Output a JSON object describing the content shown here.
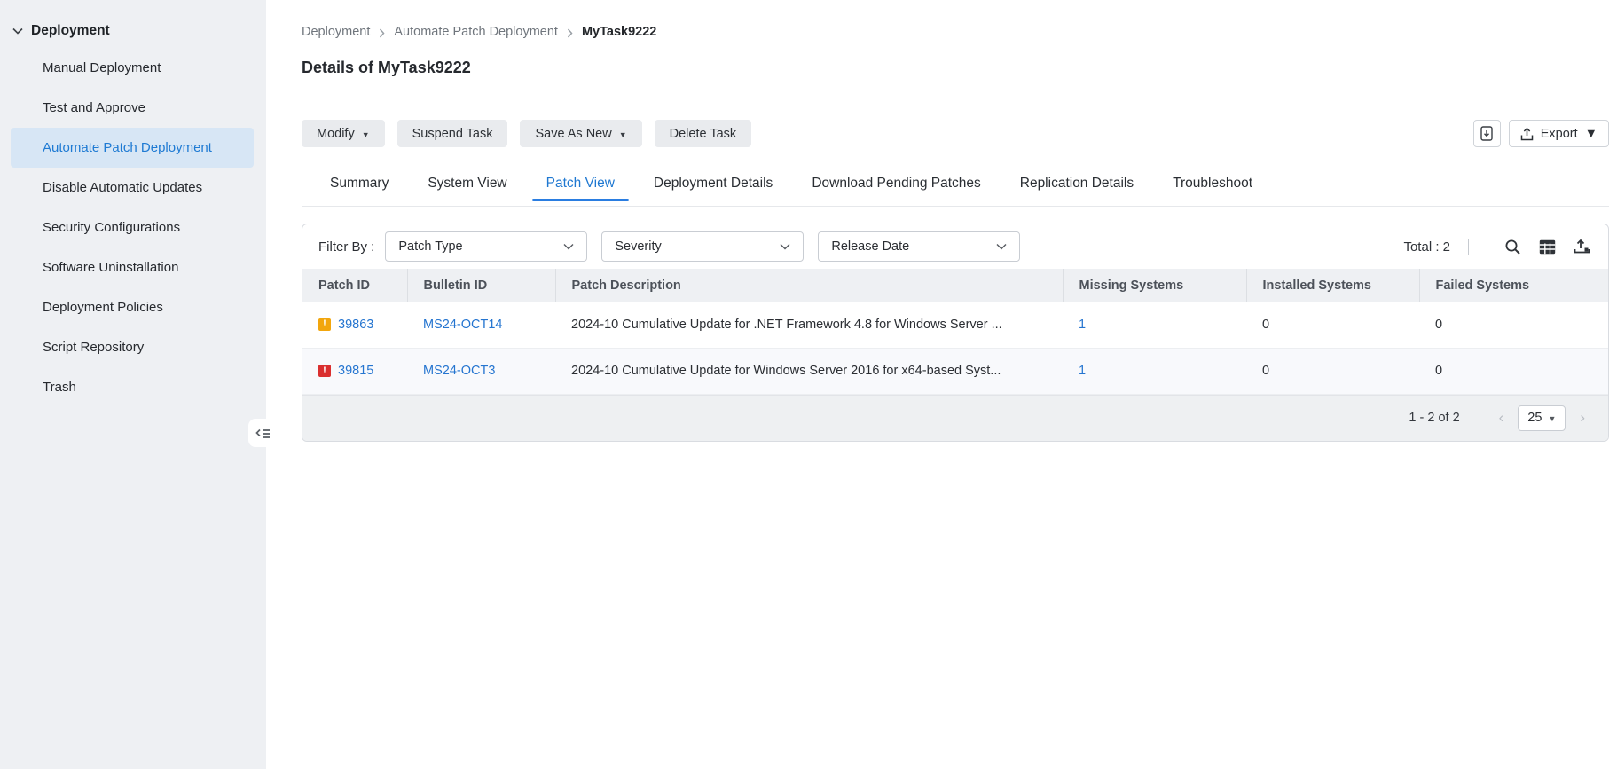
{
  "sidebar": {
    "section": "Deployment",
    "active_item": "Automate Patch Deployment",
    "items": [
      "Manual Deployment",
      "Test and Approve",
      "Automate Patch Deployment",
      "Disable Automatic Updates",
      "Security Configurations",
      "Software Uninstallation",
      "Deployment Policies",
      "Script Repository",
      "Trash"
    ]
  },
  "breadcrumb": {
    "items": [
      "Deployment",
      "Automate Patch Deployment",
      "MyTask9222"
    ]
  },
  "page": {
    "title": "Details of MyTask9222"
  },
  "toolbar": {
    "modify": "Modify",
    "suspend": "Suspend Task",
    "save_as_new": "Save As New",
    "delete": "Delete Task",
    "export": "Export"
  },
  "tabs": {
    "active": "Patch View",
    "items": [
      "Summary",
      "System View",
      "Patch View",
      "Deployment Details",
      "Download Pending Patches",
      "Replication Details",
      "Troubleshoot"
    ]
  },
  "filter": {
    "label": "Filter By :",
    "dropdowns": [
      "Patch Type",
      "Severity",
      "Release Date"
    ],
    "total": "Total : 2"
  },
  "table": {
    "columns": [
      "Patch ID",
      "Bulletin ID",
      "Patch Description",
      "Missing Systems",
      "Installed Systems",
      "Failed Systems"
    ],
    "rows": [
      {
        "severity": "important",
        "color": "#f2a60d",
        "glyph": "!",
        "patch_id": "39863",
        "bulletin_id": "MS24-OCT14",
        "description": "2024-10 Cumulative Update for .NET Framework 4.8 for Windows Server ...",
        "missing": "1",
        "installed": "0",
        "failed": "0"
      },
      {
        "severity": "critical",
        "color": "#da2f2f",
        "glyph": "!",
        "patch_id": "39815",
        "bulletin_id": "MS24-OCT3",
        "description": "2024-10 Cumulative Update for Windows Server 2016 for x64-based Syst...",
        "missing": "1",
        "installed": "0",
        "failed": "0"
      }
    ]
  },
  "pagination": {
    "range": "1 - 2 of 2",
    "page_size": "25"
  },
  "colors": {
    "accent_blue": "#1e7ad3",
    "link_blue": "#2575d0",
    "active_nav_bg": "#d7e6f5",
    "sidebar_bg": "#eef0f3",
    "severity_important": "#f2a60d",
    "severity_critical": "#da2f2f"
  }
}
